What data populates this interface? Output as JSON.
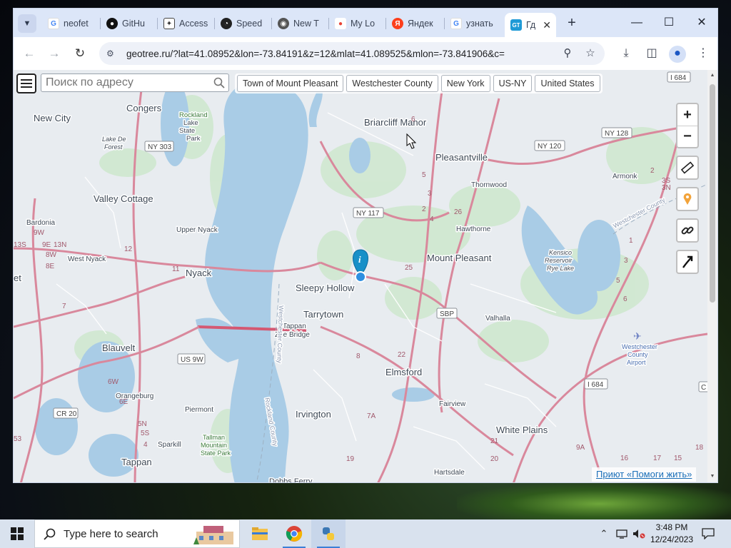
{
  "browser": {
    "tabs": [
      {
        "label": "neofet",
        "favicon": "google-icon",
        "color": "#4285f4"
      },
      {
        "label": "GitHu",
        "favicon": "github-icon",
        "color": "#111111"
      },
      {
        "label": "Access",
        "favicon": "access-icon",
        "color": "#333333"
      },
      {
        "label": "Speed",
        "favicon": "speedtest-icon",
        "color": "#222222"
      },
      {
        "label": "New T",
        "favicon": "chrome-icon",
        "color": "#444444"
      },
      {
        "label": "My Lo",
        "favicon": "maps-pin-icon",
        "color": "#ea4335"
      },
      {
        "label": "Яндек",
        "favicon": "yandex-icon",
        "color": "#fc3f1d"
      },
      {
        "label": "узнать",
        "favicon": "google-icon",
        "color": "#4285f4"
      },
      {
        "label": "Гд",
        "favicon": "geotree-icon",
        "color": "#1f9ad6",
        "fav_text": "GT"
      }
    ],
    "url": "geotree.ru/?lat=41.08952&lon=-73.84191&z=12&mlat=41.089525&mlon=-73.841906&c="
  },
  "page": {
    "search_placeholder": "Поиск по адресу",
    "breadcrumbs": [
      "Town of Mount Pleasant",
      "Westchester County",
      "New York",
      "US-NY",
      "United States"
    ],
    "zoom_in": "+",
    "zoom_out": "−",
    "attribution": "Приют «Помоги жить»"
  },
  "map": {
    "places": [
      {
        "name": "Congers"
      },
      {
        "name": "New City"
      },
      {
        "name": "Rockland"
      },
      {
        "name": "Lake"
      },
      {
        "name": "State"
      },
      {
        "name": "Park"
      },
      {
        "name": "Lake De"
      },
      {
        "name": "Forest"
      },
      {
        "name": "Briarcliff Manor"
      },
      {
        "name": "Pleasantville"
      },
      {
        "name": "Thornwood"
      },
      {
        "name": "Armonk"
      },
      {
        "name": "Valley Cottage"
      },
      {
        "name": "Bardonia"
      },
      {
        "name": "Upper Nyack"
      },
      {
        "name": "Hawthorne"
      },
      {
        "name": "West Nyack"
      },
      {
        "name": "Nyack"
      },
      {
        "name": "Mount Pleasant"
      },
      {
        "name": "Kensico"
      },
      {
        "name": "Reservoir"
      },
      {
        "name": "Rye Lake"
      },
      {
        "name": "Sleepy Hollow"
      },
      {
        "name": "Tarrytown"
      },
      {
        "name": "Tappan"
      },
      {
        "name": "Zee Bridge"
      },
      {
        "name": "Valhalla"
      },
      {
        "name": "Westchester"
      },
      {
        "name": "County"
      },
      {
        "name": "Airport"
      },
      {
        "name": "Blauvelt"
      },
      {
        "name": "Elmsford"
      },
      {
        "name": "Orangeburg"
      },
      {
        "name": "Piermont"
      },
      {
        "name": "Irvington"
      },
      {
        "name": "Fairview"
      },
      {
        "name": "White Plains"
      },
      {
        "name": "Sparkill"
      },
      {
        "name": "Tallman"
      },
      {
        "name": "Mountain"
      },
      {
        "name": "State Park"
      },
      {
        "name": "Tappan"
      },
      {
        "name": "Hartsdale"
      },
      {
        "name": "et"
      },
      {
        "name": "Dobbs Ferry"
      },
      {
        "name": "Westchester County"
      },
      {
        "name": "Westchester County"
      },
      {
        "name": "Rockland County"
      }
    ],
    "shields": [
      {
        "label": "I 684"
      },
      {
        "label": "NY 303"
      },
      {
        "label": "NY 128"
      },
      {
        "label": "NY 120"
      },
      {
        "label": "NY 117"
      },
      {
        "label": "SBP"
      },
      {
        "label": "US 9W"
      },
      {
        "label": "I 684"
      },
      {
        "label": "CR 20"
      },
      {
        "label": "C"
      }
    ],
    "route_numbers": [
      "6",
      "5",
      "3",
      "2",
      "26",
      "4",
      "25",
      "22",
      "8",
      "7A",
      "19",
      "21",
      "20",
      "9A",
      "16",
      "17",
      "18",
      "15",
      "12",
      "11",
      "9W",
      "9E",
      "13N",
      "13S",
      "8W",
      "8E",
      "6W",
      "6E",
      "5N",
      "5S",
      "4",
      "53",
      "2",
      "3N",
      "3S",
      "1",
      "3",
      "5",
      "6",
      "7"
    ]
  },
  "taskbar": {
    "search_placeholder": "Type here to search",
    "time": "3:48 PM",
    "date": "12/24/2023"
  }
}
